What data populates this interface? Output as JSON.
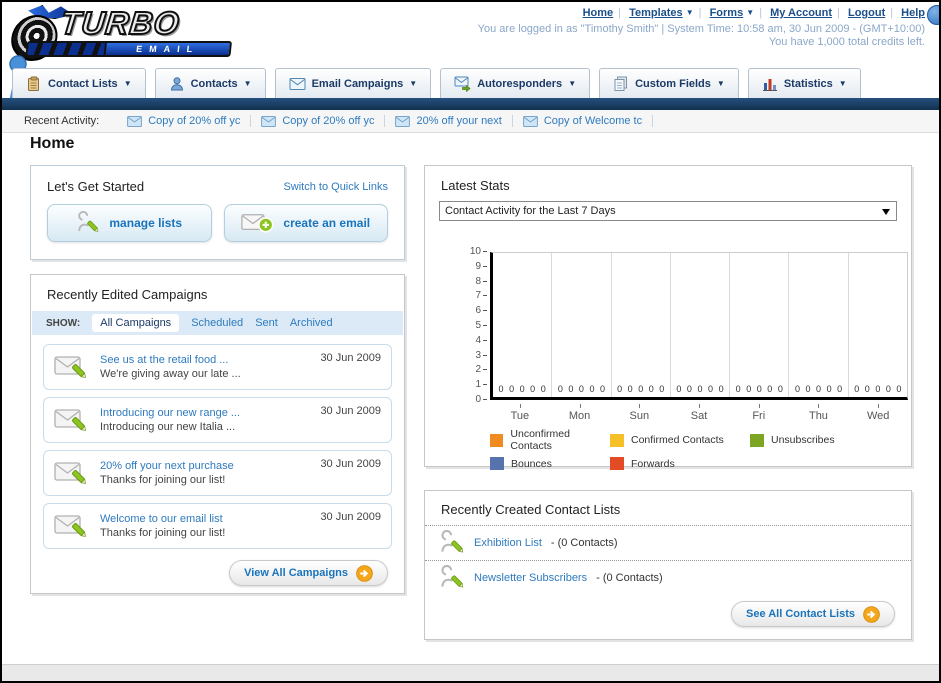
{
  "colors": {
    "accent_orange": "#f5a71c",
    "link_blue": "#2e7bbf",
    "nav_navy": "#1b3a66",
    "dark_bar": "#173a5f",
    "status_text": "#8ba7c9"
  },
  "header": {
    "logo_line1": "TURBO",
    "logo_line2": "EMAIL",
    "nav_links": [
      {
        "label": "Home",
        "dropdown": false
      },
      {
        "label": "Templates",
        "dropdown": true
      },
      {
        "label": "Forms",
        "dropdown": true
      },
      {
        "label": "My Account",
        "dropdown": false
      },
      {
        "label": "Logout",
        "dropdown": false
      },
      {
        "label": "Help",
        "dropdown": false
      }
    ],
    "login_status": "You are logged in as \"Timothy Smith\" | System Time: 10:58 am, 30 Jun 2009 - (GMT+10:00)",
    "credits": "You have 1,000 total credits left."
  },
  "tabs": [
    {
      "label": "Contact Lists",
      "icon": "contact-lists-icon"
    },
    {
      "label": "Contacts",
      "icon": "contacts-icon"
    },
    {
      "label": "Email Campaigns",
      "icon": "email-campaigns-icon"
    },
    {
      "label": "Autoresponders",
      "icon": "autoresponders-icon"
    },
    {
      "label": "Custom Fields",
      "icon": "custom-fields-icon"
    },
    {
      "label": "Statistics",
      "icon": "statistics-icon"
    }
  ],
  "activity": {
    "label": "Recent Activity:",
    "items": [
      "Copy of 20% off yc",
      "Copy of 20% off yc",
      "20% off your next",
      "Copy of Welcome tc"
    ]
  },
  "page_title": "Home",
  "get_started": {
    "title": "Let's Get Started",
    "switch_link": "Switch to Quick Links",
    "manage_lists_label": "manage lists",
    "create_email_label": "create an email"
  },
  "campaigns": {
    "title": "Recently Edited Campaigns",
    "show_label": "SHOW:",
    "filters": [
      "All Campaigns",
      "Scheduled",
      "Sent",
      "Archived"
    ],
    "active_filter": "All Campaigns",
    "items": [
      {
        "title": "See us at the retail food ...",
        "desc": "We're giving away our late ...",
        "date": "30 Jun 2009"
      },
      {
        "title": "Introducing our new range ...",
        "desc": "Introducing our new Italia ...",
        "date": "30 Jun 2009"
      },
      {
        "title": "20% off your next purchase",
        "desc": "Thanks for joining our list!",
        "date": "30 Jun 2009"
      },
      {
        "title": "Welcome to our email list",
        "desc": "Thanks for joining our list!",
        "date": "30 Jun 2009"
      }
    ],
    "view_all_label": "View All Campaigns"
  },
  "stats": {
    "title": "Latest Stats",
    "period_selected": "Contact Activity for the Last 7 Days"
  },
  "chart_data": {
    "type": "bar",
    "title": "Contact Activity for the Last 7 Days",
    "categories": [
      "Tue",
      "Mon",
      "Sun",
      "Sat",
      "Fri",
      "Thu",
      "Wed"
    ],
    "series": [
      {
        "name": "Unconfirmed Contacts",
        "color": "#f08b22",
        "values": [
          0,
          0,
          0,
          0,
          0,
          0,
          0
        ]
      },
      {
        "name": "Confirmed Contacts",
        "color": "#f5c028",
        "values": [
          0,
          0,
          0,
          0,
          0,
          0,
          0
        ]
      },
      {
        "name": "Unsubscribes",
        "color": "#7ba522",
        "values": [
          0,
          0,
          0,
          0,
          0,
          0,
          0
        ]
      },
      {
        "name": "Bounces",
        "color": "#5673ad",
        "values": [
          0,
          0,
          0,
          0,
          0,
          0,
          0
        ]
      },
      {
        "name": "Forwards",
        "color": "#e34b27",
        "values": [
          0,
          0,
          0,
          0,
          0,
          0,
          0
        ]
      }
    ],
    "ylim": [
      0,
      10
    ],
    "yticks": [
      0,
      1,
      2,
      3,
      4,
      5,
      6,
      7,
      8,
      9,
      10
    ],
    "grid": "vertical group separators",
    "legend_position": "bottom",
    "xlabel": "",
    "ylabel": ""
  },
  "contact_lists": {
    "title": "Recently Created Contact Lists",
    "items": [
      {
        "name": "Exhibition List",
        "count_suffix": "- (0 Contacts)"
      },
      {
        "name": "Newsletter Subscribers",
        "count_suffix": "- (0 Contacts)"
      }
    ],
    "see_all_label": "See All Contact Lists"
  }
}
